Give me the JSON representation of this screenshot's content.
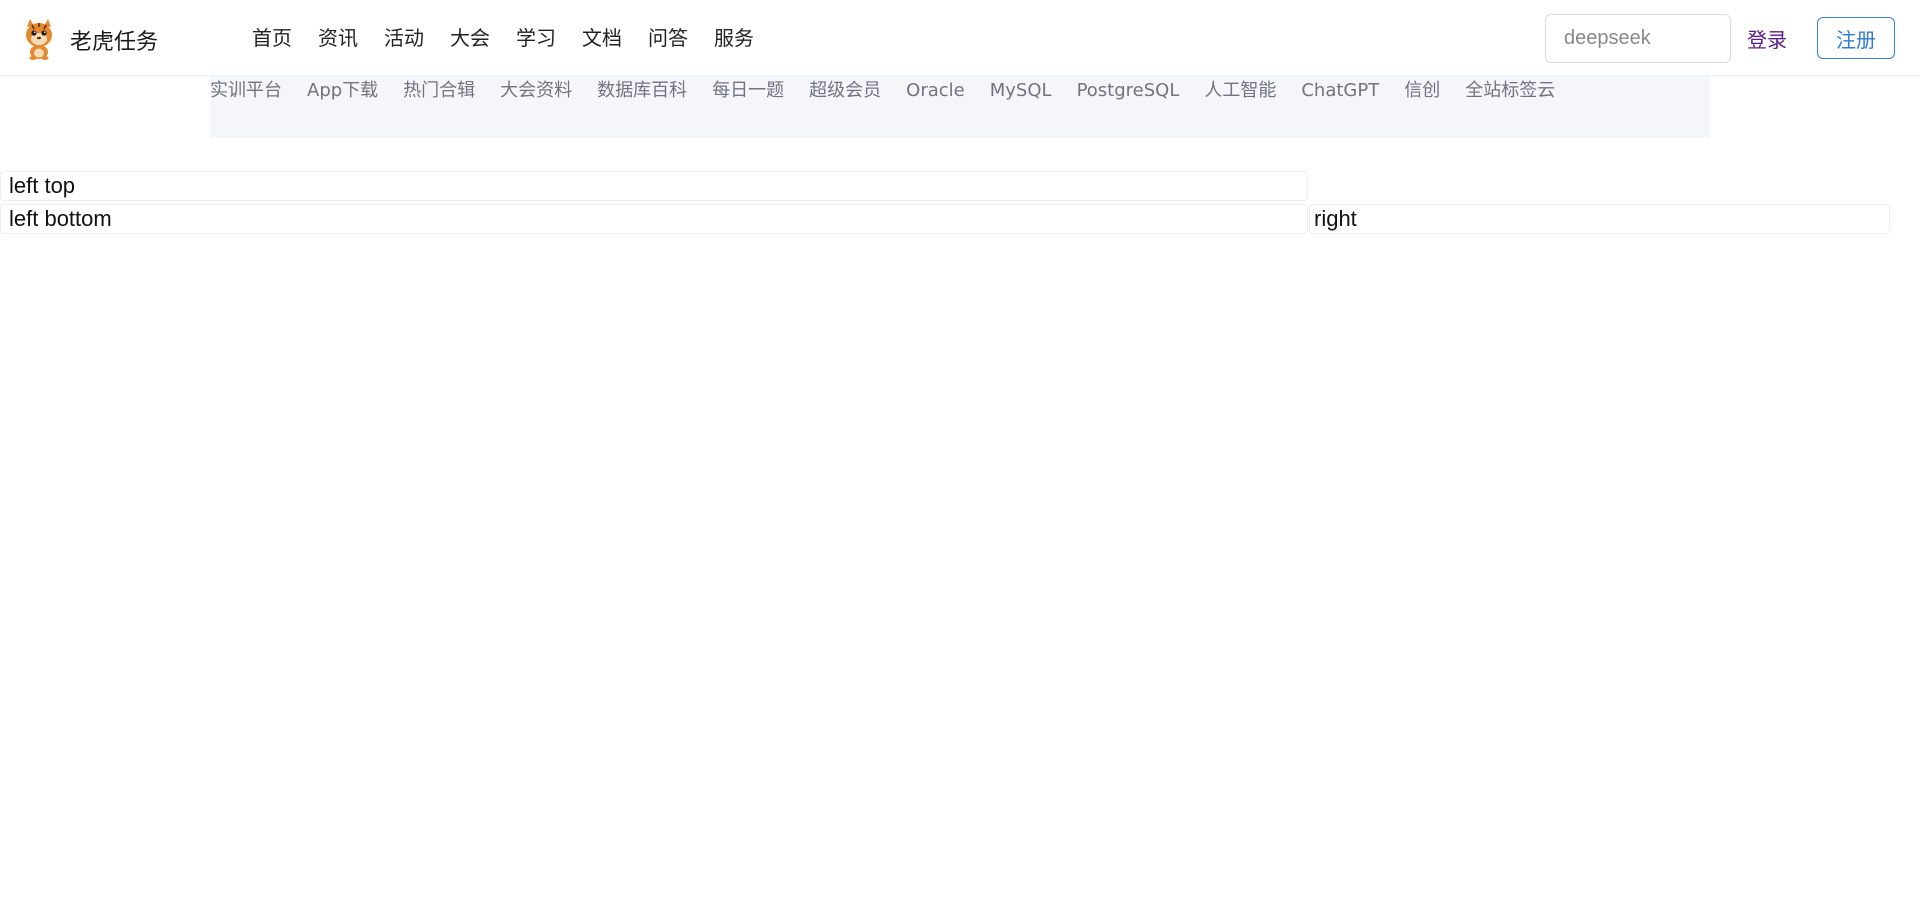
{
  "header": {
    "brand": "老虎任务",
    "nav": [
      "首页",
      "资讯",
      "活动",
      "大会",
      "学习",
      "文档",
      "问答",
      "服务"
    ],
    "search": {
      "value": "",
      "placeholder": "deepseek"
    },
    "login_label": "登录",
    "register_label": "注册",
    "colors": {
      "login": "#5b1a86",
      "register": "#2f7bd2"
    }
  },
  "subnav": {
    "items": [
      "实训平台",
      "App下载",
      "热门合辑",
      "大会资料",
      "数据库百科",
      "每日一题",
      "超级会员",
      "Oracle",
      "MySQL",
      "PostgreSQL",
      "人工智能",
      "ChatGPT",
      "信创",
      "全站标签云"
    ]
  },
  "content": {
    "left_top": "left top",
    "left_bottom": "left bottom",
    "right": "right"
  },
  "icons": {
    "logo": "tiger-mascot-icon"
  }
}
